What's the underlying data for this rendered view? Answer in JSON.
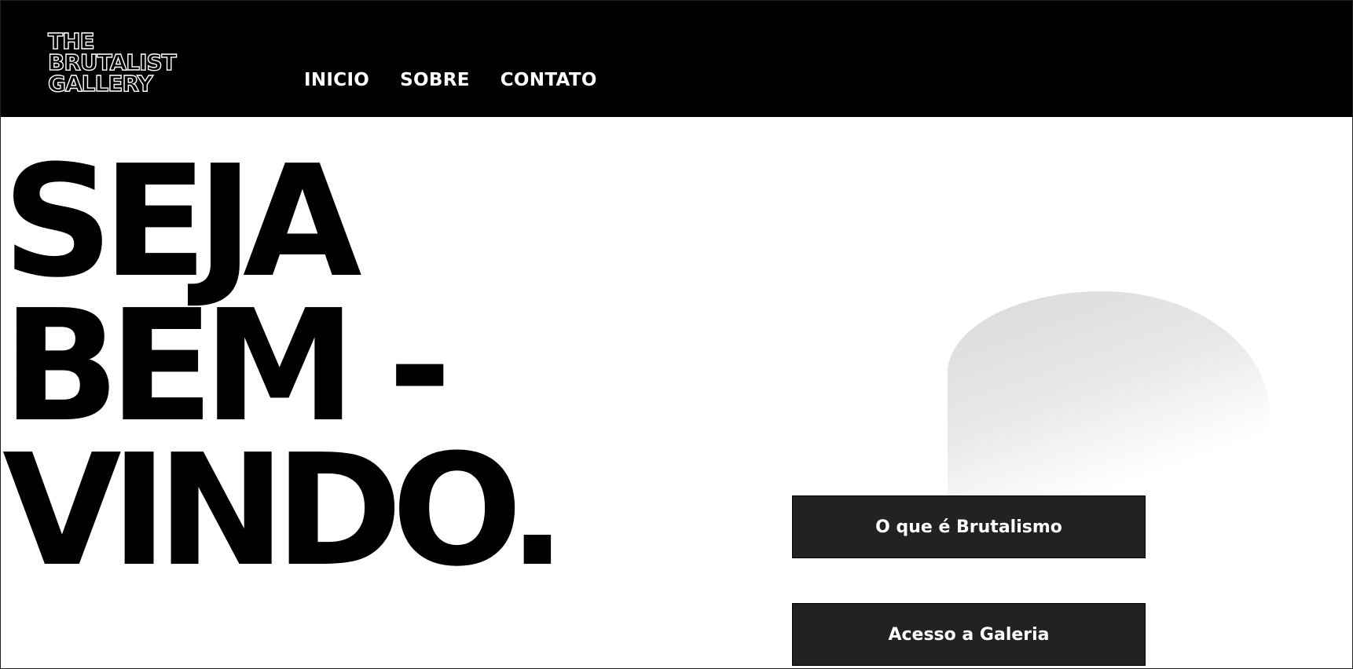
{
  "header": {
    "logo_lines": [
      "THE",
      "BRUTALIST",
      "GALLERY"
    ],
    "nav": [
      "INICIO",
      "SOBRE",
      "CONTATO"
    ]
  },
  "hero": {
    "title_lines": [
      "SEJA",
      "BEM -",
      "VINDO."
    ]
  },
  "actions": {
    "primary_label": "O que é Brutalismo",
    "secondary_label": "Acesso a Galeria"
  },
  "colors": {
    "header_bg": "#000000",
    "button_bg": "#222222",
    "text": "#000000"
  }
}
